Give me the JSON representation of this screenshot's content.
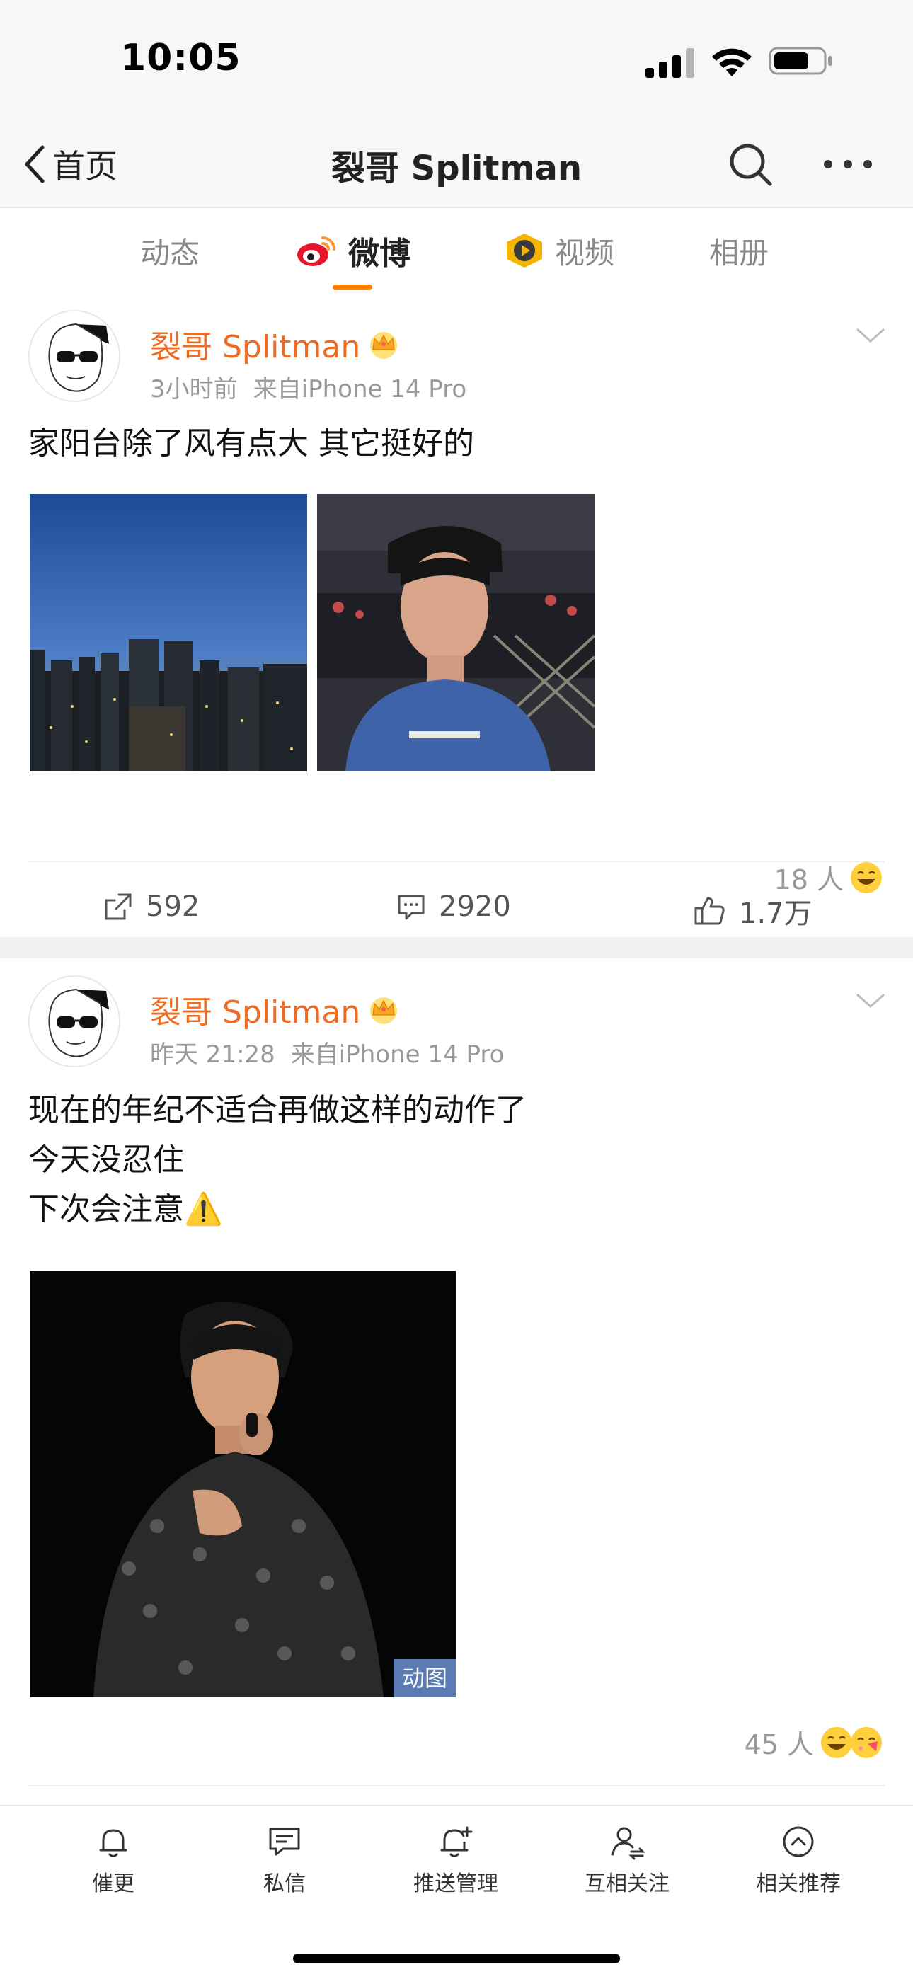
{
  "status_bar": {
    "time": "10:05"
  },
  "nav": {
    "back_label": "首页",
    "title": "裂哥 Splitman"
  },
  "tabs": [
    {
      "label": "动态"
    },
    {
      "label": "微博"
    },
    {
      "label": "视频"
    },
    {
      "label": "相册"
    }
  ],
  "active_tab": "微博",
  "posts": [
    {
      "author": "裂哥 Splitman",
      "time": "3小时前",
      "source": "来自iPhone 14 Pro",
      "text_lines": [
        "家阳台除了风有点大 其它挺好的"
      ],
      "images": [
        {
          "alt": "city skyline at dusk photo"
        },
        {
          "alt": "selfie on balcony photo"
        }
      ],
      "reaction_count": "18 人",
      "reposts": "592",
      "comments": "2920",
      "likes": "1.7万"
    },
    {
      "author": "裂哥 Splitman",
      "time": "昨天 21:28",
      "source": "来自iPhone 14 Pro",
      "text_lines": [
        "现在的年纪不适合再做这样的动作了",
        "今天没忍住",
        "下次会注意⚠️"
      ],
      "images": [
        {
          "alt": "singer performing on stage",
          "badge": "动图"
        }
      ],
      "reaction_count": "45 人"
    }
  ],
  "toolbar": [
    {
      "label": "催更",
      "icon": "bell-icon"
    },
    {
      "label": "私信",
      "icon": "message-icon"
    },
    {
      "label": "推送管理",
      "icon": "push-manage-icon"
    },
    {
      "label": "互相关注",
      "icon": "mutual-follow-icon"
    },
    {
      "label": "相关推荐",
      "icon": "recommend-icon"
    }
  ],
  "colors": {
    "accent": "#ff8200",
    "author_name": "#f06b22",
    "secondary_text": "#999999"
  }
}
